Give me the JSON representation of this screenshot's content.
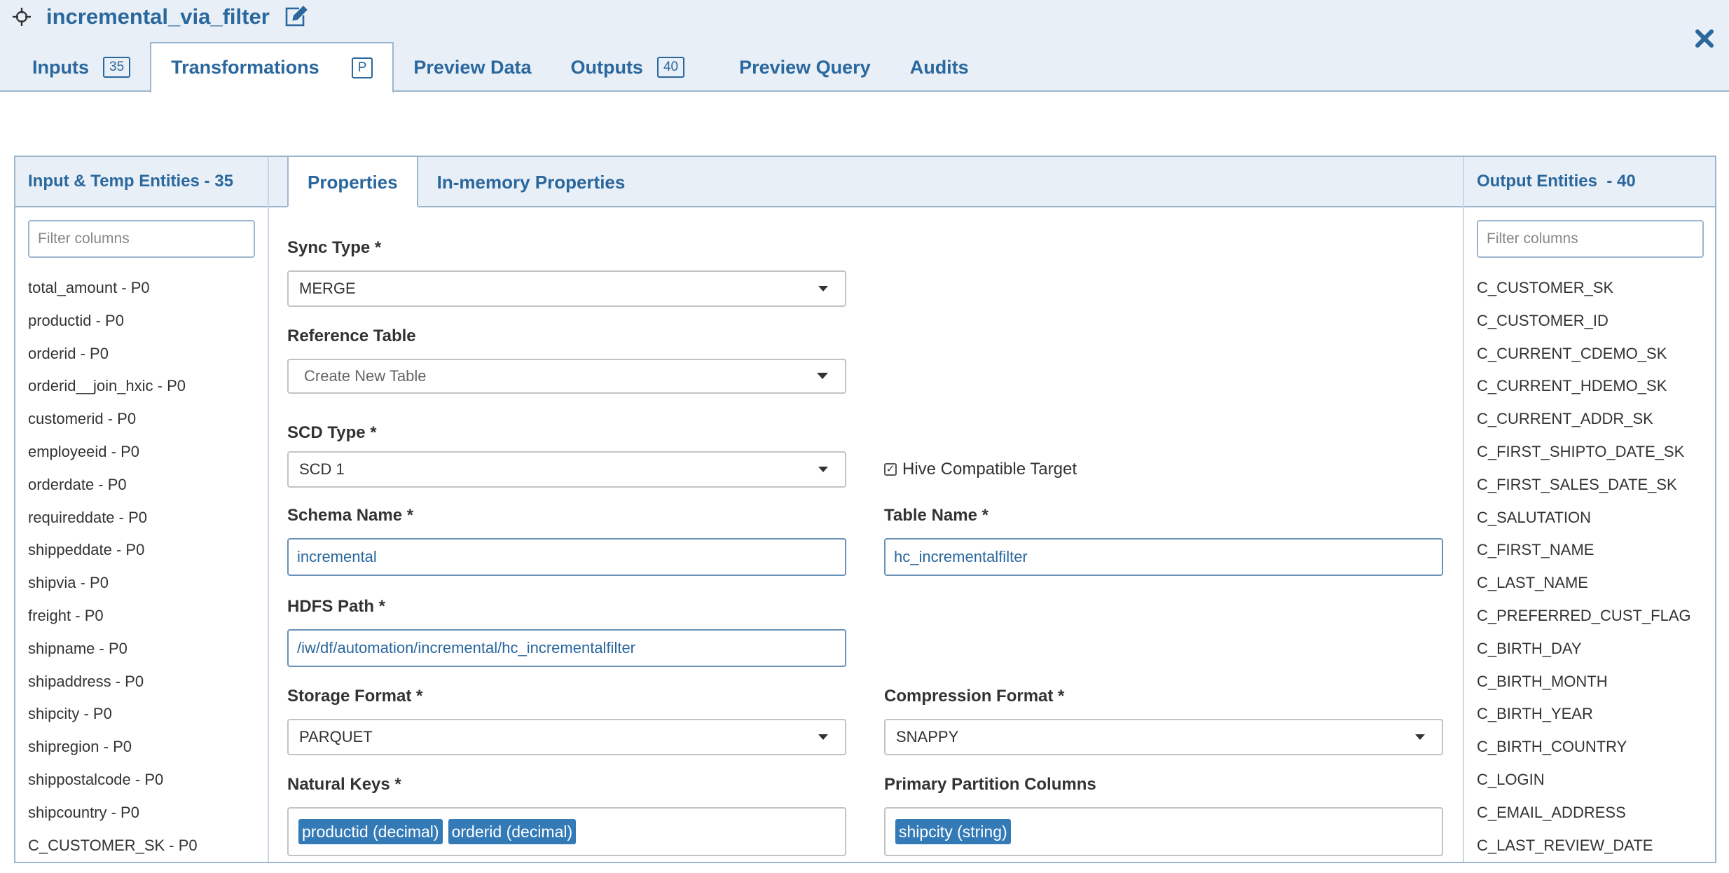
{
  "header": {
    "title": "incremental_via_filter",
    "move_icon": "move-icon",
    "edit_icon": "edit-icon",
    "close_icon": "close-icon"
  },
  "tabs": [
    {
      "label": "Inputs",
      "badge": "35"
    },
    {
      "label": "Transformations",
      "badge": "P"
    },
    {
      "label": "Preview Data"
    },
    {
      "label": "Outputs",
      "badge": "40"
    },
    {
      "label": "Preview Query"
    },
    {
      "label": "Audits"
    }
  ],
  "left_panel": {
    "title": "Input & Temp Entities - 35",
    "filter_placeholder": "Filter columns",
    "items": [
      "total_amount - P0",
      "productid - P0",
      "orderid - P0",
      "orderid__join_hxic - P0",
      "customerid - P0",
      "employeeid - P0",
      "orderdate - P0",
      "requireddate - P0",
      "shippeddate - P0",
      "shipvia - P0",
      "freight - P0",
      "shipname - P0",
      "shipaddress - P0",
      "shipcity - P0",
      "shipregion - P0",
      "shippostalcode - P0",
      "shipcountry - P0",
      "C_CUSTOMER_SK - P0"
    ]
  },
  "mid_tabs": [
    "Properties",
    "In-memory Properties"
  ],
  "form": {
    "sync_type": {
      "label": "Sync Type *",
      "value": "MERGE"
    },
    "reference_table": {
      "label": "Reference Table",
      "placeholder": "Create New Table"
    },
    "scd_type": {
      "label": "SCD Type *",
      "value": "SCD 1"
    },
    "hive_compatible": {
      "label": "Hive Compatible Target",
      "checked": true
    },
    "schema_name": {
      "label": "Schema Name *",
      "value": "incremental"
    },
    "table_name": {
      "label": "Table Name *",
      "value": "hc_incrementalfilter"
    },
    "hdfs_path": {
      "label": "HDFS Path *",
      "value": "/iw/df/automation/incremental/hc_incrementalfilter"
    },
    "storage_format": {
      "label": "Storage Format *",
      "value": "PARQUET"
    },
    "compression_format": {
      "label": "Compression Format *",
      "value": "SNAPPY"
    },
    "natural_keys": {
      "label": "Natural Keys *",
      "tags": [
        "productid (decimal)",
        "orderid (decimal)"
      ]
    },
    "primary_partition": {
      "label": "Primary Partition Columns",
      "tags": [
        "shipcity (string)"
      ]
    }
  },
  "right_panel": {
    "title": "Output Entities  - 40",
    "filter_placeholder": "Filter columns",
    "items": [
      "C_CUSTOMER_SK",
      "C_CUSTOMER_ID",
      "C_CURRENT_CDEMO_SK",
      "C_CURRENT_HDEMO_SK",
      "C_CURRENT_ADDR_SK",
      "C_FIRST_SHIPTO_DATE_SK",
      "C_FIRST_SALES_DATE_SK",
      "C_SALUTATION",
      "C_FIRST_NAME",
      "C_LAST_NAME",
      "C_PREFERRED_CUST_FLAG",
      "C_BIRTH_DAY",
      "C_BIRTH_MONTH",
      "C_BIRTH_YEAR",
      "C_BIRTH_COUNTRY",
      "C_LOGIN",
      "C_EMAIL_ADDRESS",
      "C_LAST_REVIEW_DATE"
    ]
  },
  "colors": {
    "accent": "#2a679d",
    "tag": "#337ab7",
    "header_bg": "#e8eff7",
    "border": "#9db6cf"
  }
}
